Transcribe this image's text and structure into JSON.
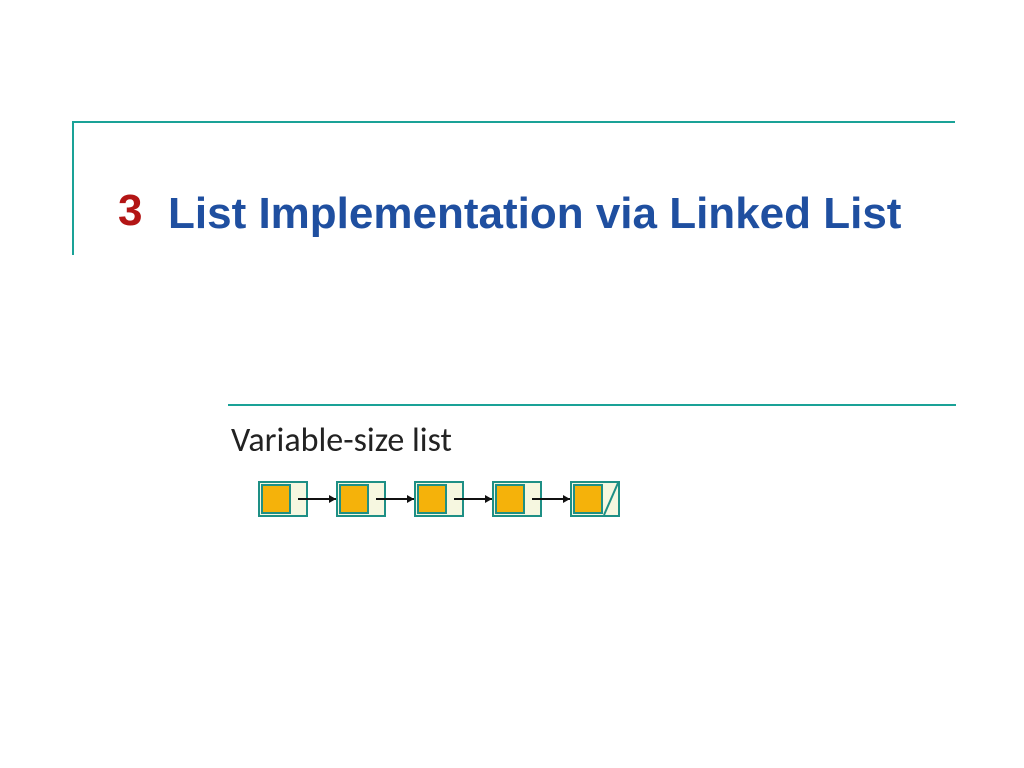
{
  "slide": {
    "section_number": "3",
    "title": "List Implementation via Linked List",
    "subtitle": "Variable-size list"
  },
  "diagram": {
    "nodes": 5,
    "colors": {
      "data_fill": "#f5b20a",
      "next_fill": "#f6f7e0",
      "border": "#1e8f85",
      "arrow": "#111111"
    }
  }
}
